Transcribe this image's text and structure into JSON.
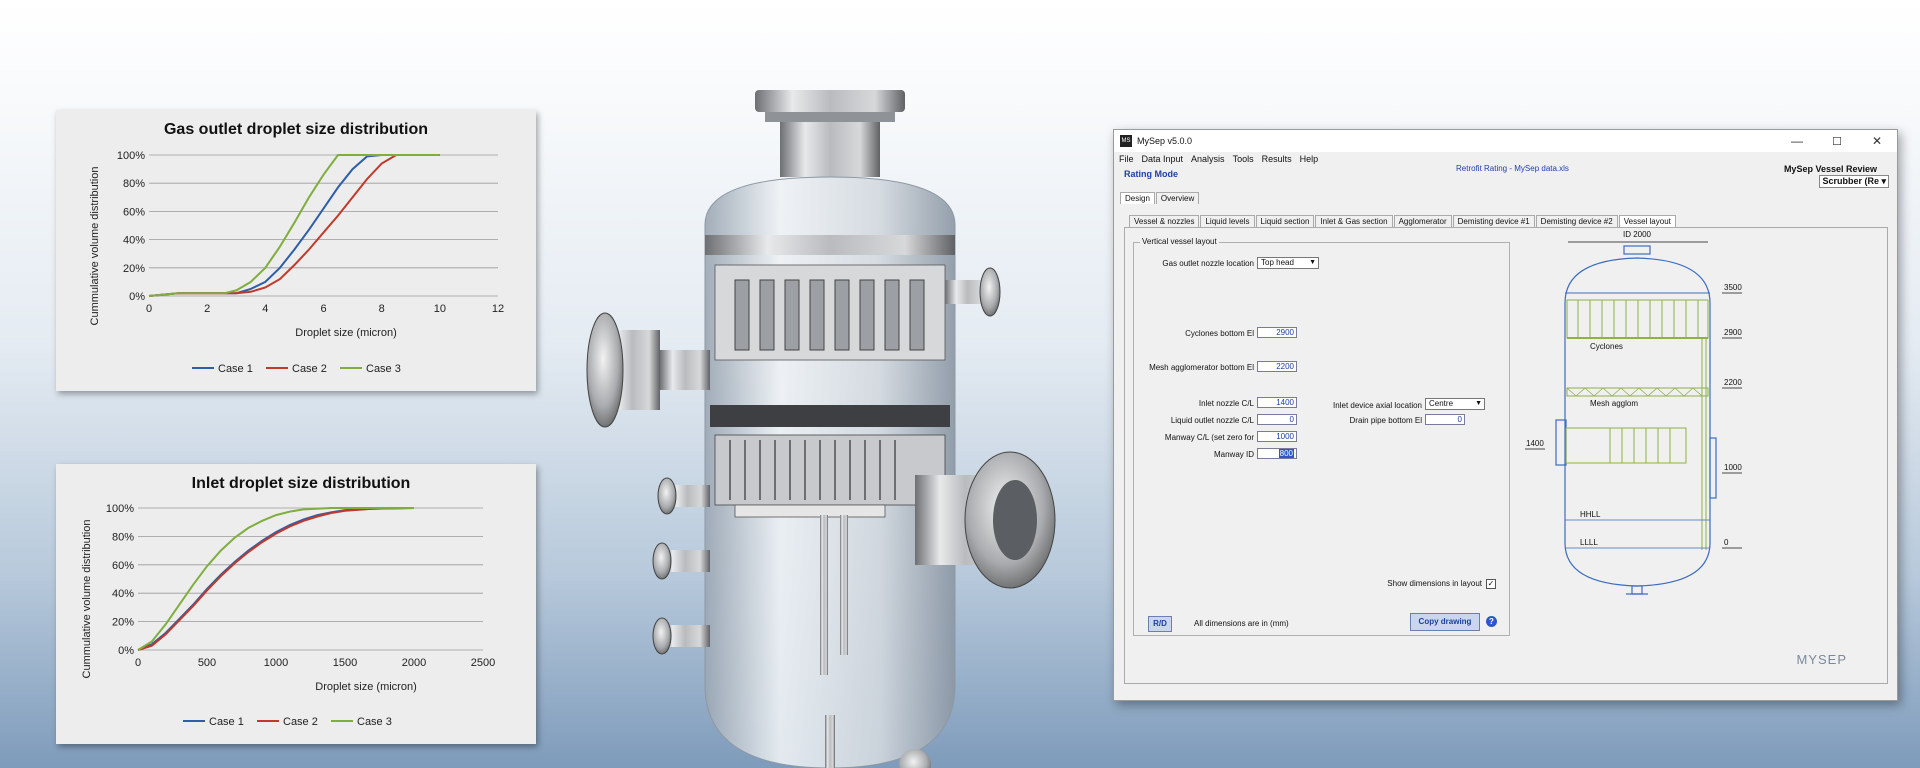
{
  "chart_data": [
    {
      "type": "line",
      "title": "Gas outlet droplet size distribution",
      "xlabel": "Droplet size (micron)",
      "ylabel": "Cummulative volume distribution",
      "xlim": [
        0,
        12
      ],
      "ylim": [
        0,
        100
      ],
      "x_ticks": [
        "0",
        "2",
        "4",
        "6",
        "8",
        "10",
        "12"
      ],
      "y_ticks": [
        "0%",
        "20%",
        "40%",
        "60%",
        "80%",
        "100%"
      ],
      "grid": true,
      "legend": "bottom",
      "series": [
        {
          "name": "Case 1",
          "color": "#2f5ea8",
          "points": [
            [
              0,
              0
            ],
            [
              1,
              2
            ],
            [
              2,
              2
            ],
            [
              3,
              2
            ],
            [
              3.5,
              5
            ],
            [
              4,
              10
            ],
            [
              4.5,
              20
            ],
            [
              5,
              33
            ],
            [
              5.5,
              47
            ],
            [
              6,
              62
            ],
            [
              6.5,
              77
            ],
            [
              7,
              90
            ],
            [
              7.5,
              99
            ],
            [
              8,
              100
            ],
            [
              10,
              100
            ]
          ]
        },
        {
          "name": "Case 2",
          "color": "#c0392b",
          "points": [
            [
              0,
              0
            ],
            [
              1,
              2
            ],
            [
              2,
              2
            ],
            [
              3,
              2
            ],
            [
              3.5,
              3
            ],
            [
              4,
              6
            ],
            [
              4.5,
              12
            ],
            [
              5,
              22
            ],
            [
              5.5,
              33
            ],
            [
              6,
              45
            ],
            [
              6.5,
              57
            ],
            [
              7,
              70
            ],
            [
              7.5,
              83
            ],
            [
              8,
              94
            ],
            [
              8.5,
              100
            ],
            [
              10,
              100
            ]
          ]
        },
        {
          "name": "Case 3",
          "color": "#7fae3e",
          "points": [
            [
              0,
              0
            ],
            [
              1,
              2
            ],
            [
              2,
              2
            ],
            [
              2.6,
              2
            ],
            [
              3,
              4
            ],
            [
              3.5,
              10
            ],
            [
              4,
              20
            ],
            [
              4.5,
              35
            ],
            [
              5,
              52
            ],
            [
              5.5,
              70
            ],
            [
              6,
              86
            ],
            [
              6.5,
              100
            ],
            [
              7,
              100
            ],
            [
              10,
              100
            ]
          ]
        }
      ]
    },
    {
      "type": "line",
      "title": "Inlet droplet size distribution",
      "xlabel": "Droplet size (micron)",
      "ylabel": "Cummulative volume distribution",
      "xlim": [
        0,
        2500
      ],
      "ylim": [
        0,
        100
      ],
      "x_ticks": [
        "0",
        "500",
        "1000",
        "1500",
        "2000",
        "2500"
      ],
      "y_ticks": [
        "0%",
        "20%",
        "40%",
        "60%",
        "80%",
        "100%"
      ],
      "grid": true,
      "legend": "bottom",
      "series": [
        {
          "name": "Case 1",
          "color": "#2f5ea8",
          "points": [
            [
              0,
              0
            ],
            [
              100,
              4
            ],
            [
              200,
              12
            ],
            [
              300,
              22
            ],
            [
              400,
              32
            ],
            [
              500,
              43
            ],
            [
              600,
              53
            ],
            [
              700,
              62
            ],
            [
              800,
              70
            ],
            [
              900,
              77
            ],
            [
              1000,
              83
            ],
            [
              1100,
              88
            ],
            [
              1200,
              92
            ],
            [
              1300,
              95
            ],
            [
              1400,
              97
            ],
            [
              1500,
              98.5
            ],
            [
              1700,
              99.5
            ],
            [
              2000,
              100
            ]
          ]
        },
        {
          "name": "Case 2",
          "color": "#c0392b",
          "points": [
            [
              0,
              0
            ],
            [
              100,
              3
            ],
            [
              200,
              11
            ],
            [
              300,
              21
            ],
            [
              400,
              31
            ],
            [
              500,
              42
            ],
            [
              600,
              52
            ],
            [
              700,
              61
            ],
            [
              800,
              69
            ],
            [
              900,
              76
            ],
            [
              1000,
              82
            ],
            [
              1100,
              87
            ],
            [
              1200,
              91
            ],
            [
              1300,
              94
            ],
            [
              1400,
              96.5
            ],
            [
              1500,
              98
            ],
            [
              1700,
              99.5
            ],
            [
              2000,
              100
            ]
          ]
        },
        {
          "name": "Case 3",
          "color": "#7fae3e",
          "points": [
            [
              0,
              0
            ],
            [
              100,
              6
            ],
            [
              200,
              18
            ],
            [
              300,
              32
            ],
            [
              400,
              46
            ],
            [
              500,
              59
            ],
            [
              600,
              70
            ],
            [
              700,
              79
            ],
            [
              800,
              86
            ],
            [
              900,
              91
            ],
            [
              1000,
              95
            ],
            [
              1100,
              97.5
            ],
            [
              1200,
              99
            ],
            [
              1400,
              100
            ],
            [
              2000,
              100
            ]
          ]
        }
      ]
    }
  ],
  "app": {
    "window_title": "MySep  v5.0.0",
    "logo_text": "MS",
    "menu": [
      "File",
      "Data Input",
      "Analysis",
      "Tools",
      "Results",
      "Help"
    ],
    "mode": "Rating Mode",
    "file_label": "Retrofit Rating - MySep data.xls",
    "review_title": "MySep Vessel Review",
    "vessel_type": "Scrubber (Re",
    "main_tabs": [
      "Design",
      "Overview"
    ],
    "sub_tabs": [
      "Vessel & nozzles",
      "Liquid levels",
      "Liquid section",
      "Inlet & Gas section",
      "Agglomerator",
      "Demisting device #1",
      "Demisting device #2",
      "Vessel layout"
    ],
    "group_title": "Vertical vessel layout",
    "fields": {
      "gas_outlet_label": "Gas outlet nozzle location",
      "gas_outlet_value": "Top head",
      "cyclones_label": "Cyclones bottom El",
      "cyclones_value": "2900",
      "mesh_label": "Mesh agglomerator bottom El",
      "mesh_value": "2200",
      "inlet_nozzle_label": "Inlet nozzle C/L",
      "inlet_nozzle_value": "1400",
      "liquid_outlet_label": "Liquid outlet nozzle C/L",
      "liquid_outlet_value": "0",
      "manway_label": "Manway C/L (set zero for",
      "manway_value": "1000",
      "manway_id_label": "Manway ID",
      "manway_id_value": "800",
      "inlet_device_label": "Inlet device axial location",
      "inlet_device_value": "Centre",
      "drain_label": "Drain pipe bottom El",
      "drain_value": "0"
    },
    "show_dims_label": "Show dimensions in layout",
    "show_dims_checked": "✓",
    "rd_button": "R/D",
    "units_label": "All dimensions are in (mm)",
    "copy_button": "Copy drawing",
    "help": "?",
    "drawing": {
      "id_label": "ID 2000",
      "elev_3500": "3500",
      "elev_2900": "2900",
      "elev_2200": "2200",
      "elev_1400": "1400",
      "elev_1000": "1000",
      "elev_0": "0",
      "cyclones": "Cyclones",
      "mesh": "Mesh agglom",
      "hhll": "HHLL",
      "llll": "LLLL"
    },
    "brand": "MYSEP",
    "window_controls": [
      "—",
      "☐",
      "✕"
    ]
  }
}
